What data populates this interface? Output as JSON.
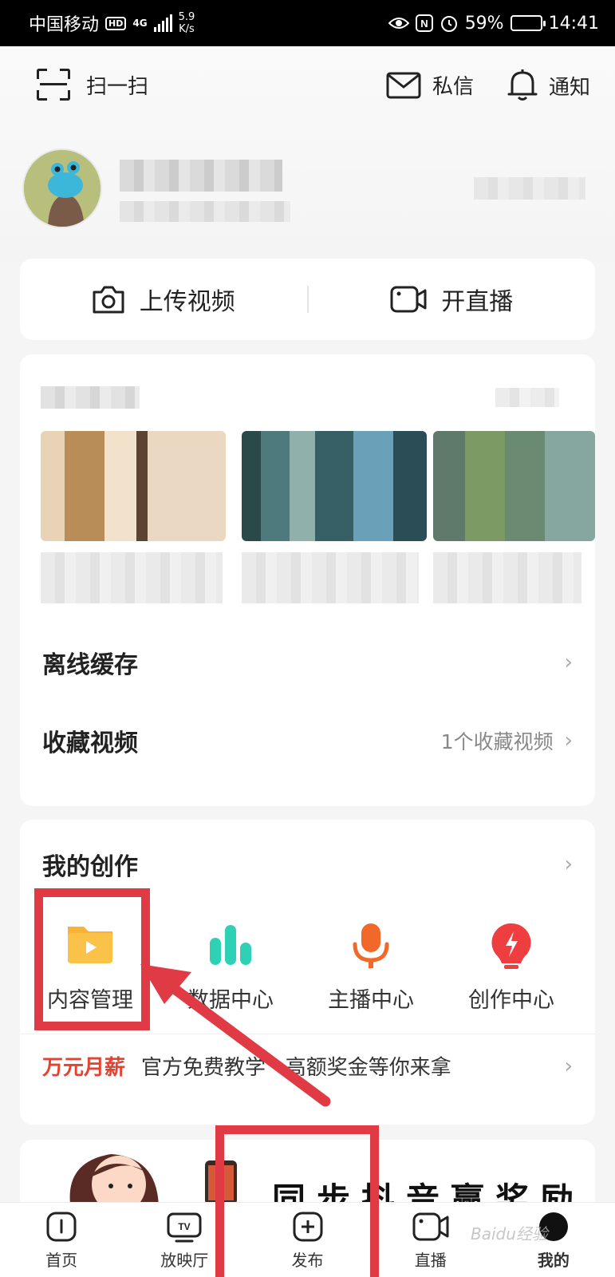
{
  "status_bar": {
    "carrier": "中国移动",
    "hd": "HD",
    "network": "4G",
    "speed": "5.9\nK/s",
    "battery": "59%",
    "battery_level": 0.59,
    "time": "14:41"
  },
  "top_bar": {
    "scan_label": "扫一扫",
    "message_label": "私信",
    "notify_label": "通知"
  },
  "quick_actions": {
    "upload_label": "上传视频",
    "live_label": "开直播"
  },
  "library": {
    "offline_label": "离线缓存",
    "favorites_label": "收藏视频",
    "favorites_count": "1个收藏视频"
  },
  "creation": {
    "title": "我的创作",
    "tools": [
      {
        "label": "内容管理",
        "icon": "folder-play-icon",
        "color": "#f9b233"
      },
      {
        "label": "数据中心",
        "icon": "bar-chart-icon",
        "color": "#2ed1b5"
      },
      {
        "label": "主播中心",
        "icon": "microphone-icon",
        "color": "#f2682a"
      },
      {
        "label": "创作中心",
        "icon": "lightning-bulb-icon",
        "color": "#ee3e40"
      }
    ],
    "promo_highlight": "万元月薪",
    "promo_text": "官方免费教学   高额奖金等你来拿"
  },
  "banner": {
    "text": "同步抖音赢奖励"
  },
  "bottom_nav": [
    {
      "label": "首页",
      "icon": "home-icon"
    },
    {
      "label": "放映厅",
      "icon": "tv-icon"
    },
    {
      "label": "发布",
      "icon": "plus-icon"
    },
    {
      "label": "直播",
      "icon": "camera-icon"
    },
    {
      "label": "我的",
      "icon": "profile-icon"
    }
  ],
  "watermark": "Baidu经验",
  "colors": {
    "accent_red": "#e03a45",
    "promo_red": "#e5422f"
  }
}
